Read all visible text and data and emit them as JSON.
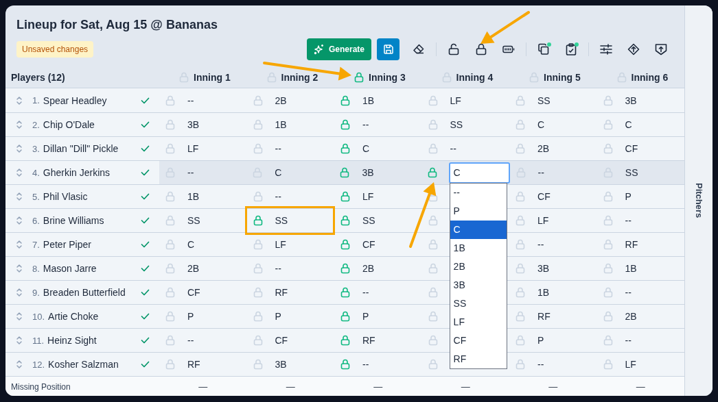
{
  "title": "Lineup for Sat, Aug 15 @ Bananas",
  "status_badge": "Unsaved changes",
  "toolbar": [
    [
      {
        "kind": "generate",
        "label": "Generate"
      },
      {
        "kind": "save"
      },
      {
        "kind": "eraser",
        "dot": false
      }
    ],
    [
      {
        "kind": "unlock",
        "dot": false
      },
      {
        "kind": "lock",
        "dot": false
      },
      {
        "kind": "battery",
        "dot": false
      }
    ],
    [
      {
        "kind": "copy",
        "dot": true
      },
      {
        "kind": "clipboard",
        "dot": true
      }
    ],
    [
      {
        "kind": "sliders",
        "dot": false
      },
      {
        "kind": "diamond",
        "dot": false
      },
      {
        "kind": "shield",
        "dot": false
      }
    ]
  ],
  "players_label": "Players (12)",
  "innings": [
    {
      "label": "Inning 1",
      "locked": false
    },
    {
      "label": "Inning 2",
      "locked": false
    },
    {
      "label": "Inning 3",
      "locked": true
    },
    {
      "label": "Inning 4",
      "locked": false
    },
    {
      "label": "Inning 5",
      "locked": false
    },
    {
      "label": "Inning 6",
      "locked": false
    }
  ],
  "rows": [
    {
      "number": "1.",
      "name": "Spear Headley",
      "checked": true,
      "highlighted": false,
      "cells": [
        {
          "value": "--",
          "locked": false
        },
        {
          "value": "2B",
          "locked": false
        },
        {
          "value": "1B",
          "locked": true
        },
        {
          "value": "LF",
          "locked": false
        },
        {
          "value": "SS",
          "locked": false
        },
        {
          "value": "3B",
          "locked": false
        }
      ]
    },
    {
      "number": "2.",
      "name": "Chip O'Dale",
      "checked": true,
      "highlighted": false,
      "cells": [
        {
          "value": "3B",
          "locked": false
        },
        {
          "value": "1B",
          "locked": false
        },
        {
          "value": "--",
          "locked": true
        },
        {
          "value": "SS",
          "locked": false
        },
        {
          "value": "C",
          "locked": false
        },
        {
          "value": "C",
          "locked": false
        }
      ]
    },
    {
      "number": "3.",
      "name": "Dillan \"Dill\" Pickle",
      "checked": true,
      "highlighted": false,
      "cells": [
        {
          "value": "LF",
          "locked": false
        },
        {
          "value": "--",
          "locked": false
        },
        {
          "value": "C",
          "locked": true
        },
        {
          "value": "--",
          "locked": false
        },
        {
          "value": "2B",
          "locked": false
        },
        {
          "value": "CF",
          "locked": false
        }
      ]
    },
    {
      "number": "4.",
      "name": "Gherkin Jerkins",
      "checked": true,
      "highlighted": true,
      "cells": [
        {
          "value": "--",
          "locked": false
        },
        {
          "value": "C",
          "locked": false
        },
        {
          "value": "3B",
          "locked": true
        },
        {
          "kind": "select",
          "value": "C",
          "locked": true,
          "options": [
            {
              "label": "--",
              "selected": false
            },
            {
              "label": "P",
              "selected": false
            },
            {
              "label": "C",
              "selected": true
            },
            {
              "label": "1B",
              "selected": false
            },
            {
              "label": "2B",
              "selected": false
            },
            {
              "label": "3B",
              "selected": false
            },
            {
              "label": "SS",
              "selected": false
            },
            {
              "label": "LF",
              "selected": false
            },
            {
              "label": "CF",
              "selected": false
            },
            {
              "label": "RF",
              "selected": false
            }
          ]
        },
        {
          "value": "--",
          "locked": false
        },
        {
          "value": "SS",
          "locked": false
        }
      ]
    },
    {
      "number": "5.",
      "name": "Phil Vlasic",
      "checked": true,
      "highlighted": false,
      "cells": [
        {
          "value": "1B",
          "locked": false
        },
        {
          "value": "--",
          "locked": false
        },
        {
          "value": "LF",
          "locked": true
        },
        {
          "locked": false
        },
        {
          "value": "CF",
          "locked": false
        },
        {
          "value": "P",
          "locked": false
        }
      ]
    },
    {
      "number": "6.",
      "name": "Brine Williams",
      "checked": true,
      "highlighted": false,
      "cells": [
        {
          "value": "SS",
          "locked": false
        },
        {
          "value": "SS",
          "locked": true,
          "framed": true
        },
        {
          "value": "SS",
          "locked": true
        },
        {
          "locked": false
        },
        {
          "value": "LF",
          "locked": false
        },
        {
          "value": "--",
          "locked": false
        }
      ]
    },
    {
      "number": "7.",
      "name": "Peter Piper",
      "checked": true,
      "highlighted": false,
      "cells": [
        {
          "value": "C",
          "locked": false
        },
        {
          "value": "LF",
          "locked": false
        },
        {
          "value": "CF",
          "locked": true
        },
        {
          "locked": false
        },
        {
          "value": "--",
          "locked": false
        },
        {
          "value": "RF",
          "locked": false
        }
      ]
    },
    {
      "number": "8.",
      "name": "Mason Jarre",
      "checked": true,
      "highlighted": false,
      "cells": [
        {
          "value": "2B",
          "locked": false
        },
        {
          "value": "--",
          "locked": false
        },
        {
          "value": "2B",
          "locked": true
        },
        {
          "locked": false
        },
        {
          "value": "3B",
          "locked": false
        },
        {
          "value": "1B",
          "locked": false
        }
      ]
    },
    {
      "number": "9.",
      "name": "Breaden Butterfield",
      "checked": true,
      "highlighted": false,
      "cells": [
        {
          "value": "CF",
          "locked": false
        },
        {
          "value": "RF",
          "locked": false
        },
        {
          "value": "--",
          "locked": true
        },
        {
          "locked": false
        },
        {
          "value": "1B",
          "locked": false
        },
        {
          "value": "--",
          "locked": false
        }
      ]
    },
    {
      "number": "10.",
      "name": "Artie Choke",
      "checked": true,
      "highlighted": false,
      "cells": [
        {
          "value": "P",
          "locked": false
        },
        {
          "value": "P",
          "locked": false
        },
        {
          "value": "P",
          "locked": true
        },
        {
          "locked": false
        },
        {
          "value": "RF",
          "locked": false
        },
        {
          "value": "2B",
          "locked": false
        }
      ]
    },
    {
      "number": "11.",
      "name": "Heinz Sight",
      "checked": true,
      "highlighted": false,
      "cells": [
        {
          "value": "--",
          "locked": false
        },
        {
          "value": "CF",
          "locked": false
        },
        {
          "value": "RF",
          "locked": true
        },
        {
          "locked": false
        },
        {
          "value": "P",
          "locked": false
        },
        {
          "value": "--",
          "locked": false
        }
      ]
    },
    {
      "number": "12.",
      "name": "Kosher Salzman",
      "checked": true,
      "highlighted": false,
      "cells": [
        {
          "value": "RF",
          "locked": false
        },
        {
          "value": "3B",
          "locked": false
        },
        {
          "value": "--",
          "locked": true
        },
        {
          "locked": false
        },
        {
          "value": "--",
          "locked": false
        },
        {
          "value": "LF",
          "locked": false
        }
      ]
    }
  ],
  "footer": {
    "label": "Missing Position",
    "values": [
      "—",
      "—",
      "—",
      "—",
      "—",
      "—"
    ]
  },
  "sidebar": {
    "label": "Pitchers"
  },
  "annotations": [
    {
      "kind": "arrow_to_toolbar"
    },
    {
      "kind": "arrow_to_header"
    },
    {
      "kind": "arrow_to_cell"
    }
  ]
}
